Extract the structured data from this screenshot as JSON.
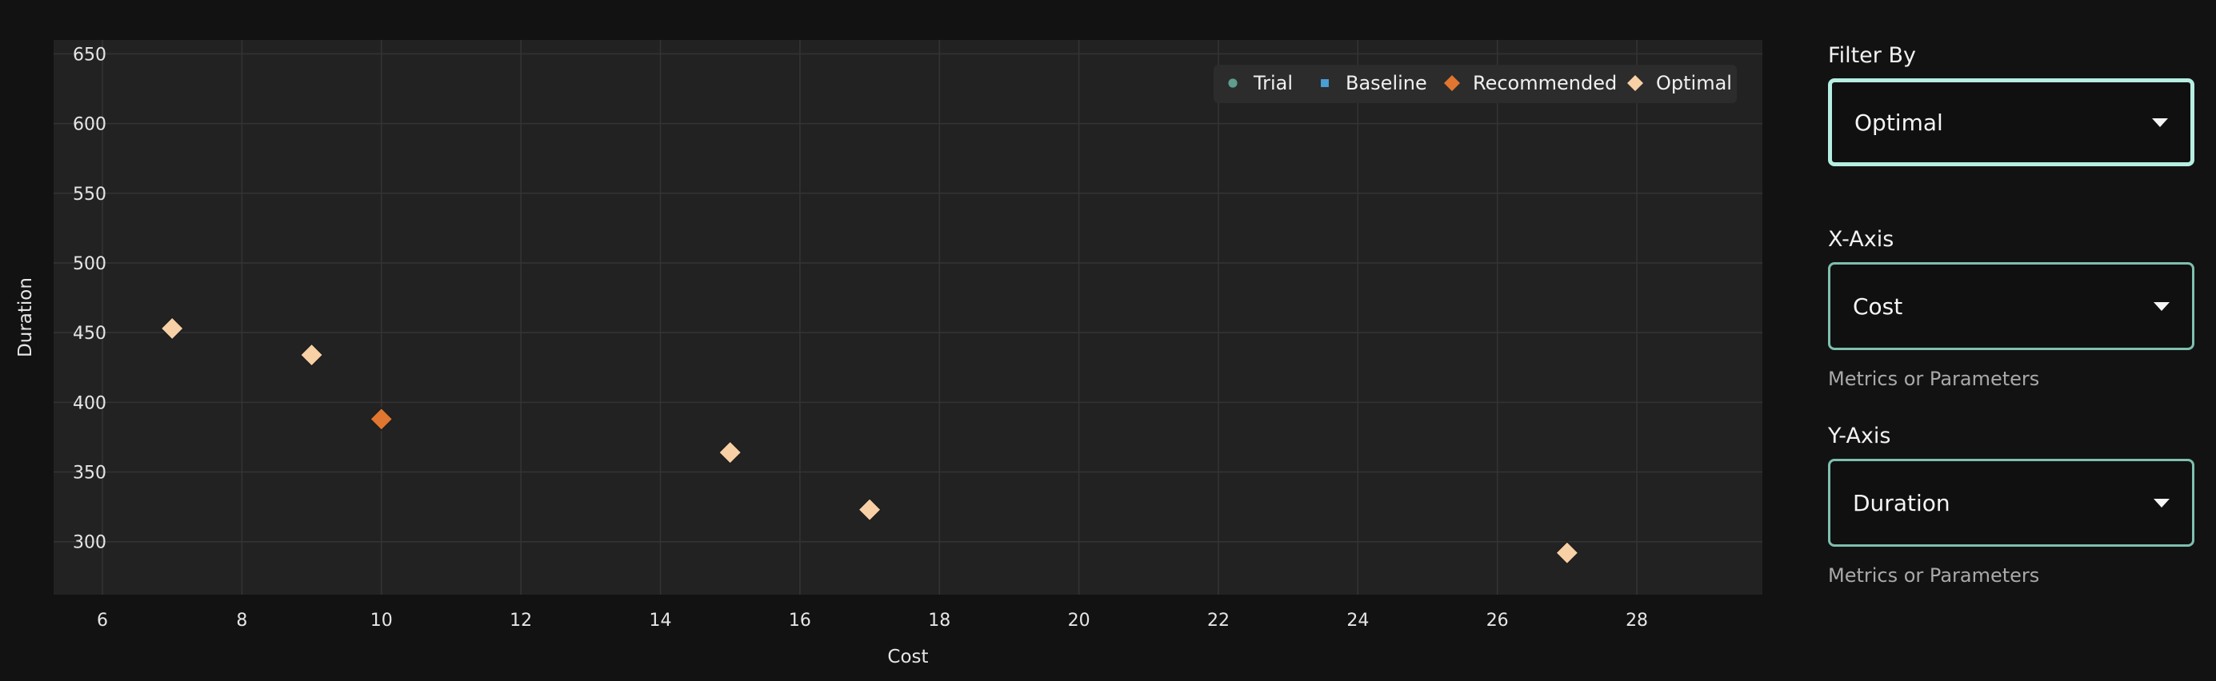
{
  "chart_data": {
    "type": "scatter",
    "xlabel": "Cost",
    "ylabel": "Duration",
    "xlim": [
      5.3,
      29.8
    ],
    "ylim": [
      262,
      660
    ],
    "x_ticks": [
      6,
      8,
      10,
      12,
      14,
      16,
      18,
      20,
      22,
      24,
      26,
      28
    ],
    "y_ticks": [
      300,
      350,
      400,
      450,
      500,
      550,
      600,
      650
    ],
    "grid": true,
    "legend_position": "top-right",
    "series": [
      {
        "name": "Trial",
        "marker": "circle",
        "color": "#5f9e8f",
        "points": []
      },
      {
        "name": "Baseline",
        "marker": "square",
        "color": "#4a9fd6",
        "points": []
      },
      {
        "name": "Recommended",
        "marker": "diamond",
        "color": "#e0762f",
        "points": [
          [
            10,
            388
          ]
        ]
      },
      {
        "name": "Optimal",
        "marker": "diamond",
        "color": "#f8d0a5",
        "points": [
          [
            7,
            453
          ],
          [
            9,
            434
          ],
          [
            15,
            364
          ],
          [
            17,
            323
          ],
          [
            27,
            292
          ]
        ]
      }
    ]
  },
  "controls": {
    "filter": {
      "label": "Filter By",
      "value": "Optimal"
    },
    "x_axis": {
      "label": "X-Axis",
      "value": "Cost",
      "helper": "Metrics or Parameters"
    },
    "y_axis": {
      "label": "Y-Axis",
      "value": "Duration",
      "helper": "Metrics or Parameters"
    }
  }
}
